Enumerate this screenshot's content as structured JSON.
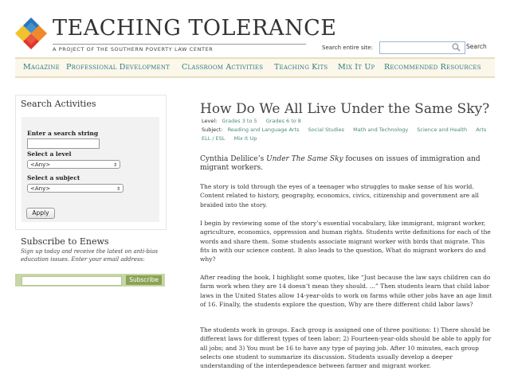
{
  "header": {
    "site_title": "TEACHING TOLERANCE",
    "tagline": "A PROJECT OF THE SOUTHERN POVERTY LAW CENTER",
    "search_label": "Search entire site:",
    "search_button": "Search"
  },
  "nav": {
    "items": [
      "Magazine",
      "Professional Development",
      "Classroom Activities",
      "Teaching Kits",
      "Mix It Up",
      "Recommended Resources"
    ]
  },
  "sidebar": {
    "heading": "Search Activities",
    "search_string_label": "Enter a search string",
    "level_label": "Select a level",
    "level_value": "<Any>",
    "subject_label": "Select a subject",
    "subject_value": "<Any>",
    "apply_button": "Apply",
    "enews_heading": "Subscribe to Enews",
    "enews_desc": "Sign up today and receive the latest on anti-bias education issues. Enter your email address:",
    "subscribe_button": "Subscribe"
  },
  "article": {
    "title": "How Do We All Live Under the Same Sky?",
    "level_key": "Level:",
    "levels": [
      "Grades 3 to 5",
      "Grades 6 to 8"
    ],
    "subject_key": "Subject:",
    "subjects": [
      "Reading and Language Arts",
      "Social Studies",
      "Math and Technology",
      "Science and Health",
      "Arts"
    ],
    "subjects_row2": [
      "ELL / ESL",
      "Mix It Up"
    ],
    "lead_before": "Cynthia Delilice’s ",
    "lead_book": "Under The Same Sky",
    "lead_after": " focuses on issues of immigration and migrant workers.",
    "paragraphs": [
      "The story is told through the eyes of a teenager who struggles to make sense of his world. Content related to history, geography, economics, civics, citizenship and government are all braided into the story.",
      "I begin by reviewing some of the story’s essential vocabulary, like immigrant, migrant worker, agriculture, economics, oppression and human rights. Students write definitions for each of the words and share them. Some students associate migrant worker with birds that migrate. This fits in with our science content. It also leads to the question, What do migrant workers do and why?",
      "After reading the book, I highlight some quotes, like “Just because the law says children can do farm work when they are 14 doesn’t mean they should. ...” Then students learn that child labor laws in the United States allow 14-year-olds to work on farms while other jobs have an age limit of 16. Finally, the students explore the question, Why are there different child labor laws?",
      "The students work in groups. Each group is assigned one of three positions: 1) There should be different laws for different types of teen labor; 2) Fourteen-year-olds should be able to apply for all jobs; and 3) You must be 16 to have any type of paying job. After 10 minutes, each group selects one student to summarize its discussion. Students usually develop a deeper understanding of the interdependence between farmer and migrant worker."
    ]
  }
}
